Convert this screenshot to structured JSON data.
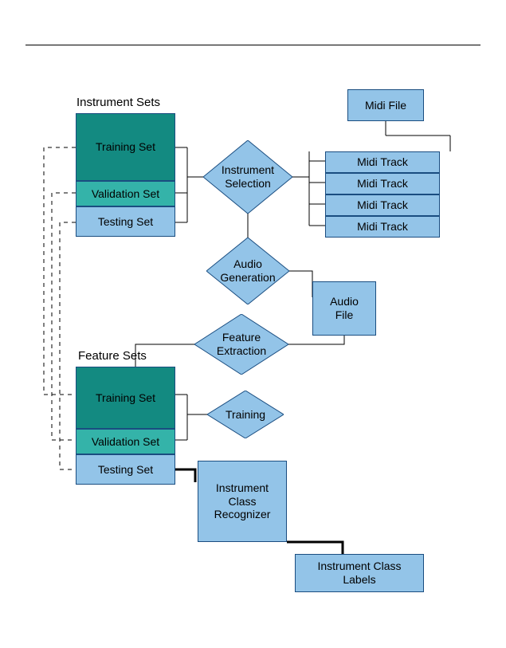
{
  "labels": {
    "instrument_sets": "Instrument Sets",
    "feature_sets": "Feature Sets"
  },
  "instrument_sets": {
    "training": "Training Set",
    "validation": "Validation Set",
    "testing": "Testing Set"
  },
  "feature_sets": {
    "training": "Training Set",
    "validation": "Validation Set",
    "testing": "Testing Set"
  },
  "midi": {
    "file": "Midi File",
    "track": "Midi Track"
  },
  "audio_file": "Audio\nFile",
  "diamonds": {
    "instrument_selection": "Instrument\nSelection",
    "audio_generation": "Audio\nGeneration",
    "feature_extraction": "Feature\nExtraction",
    "training": "Training"
  },
  "recognizer": "Instrument\nClass\nRecognizer",
  "output_labels": "Instrument Class\nLabels",
  "colors": {
    "box_fill": "#93c4e8",
    "box_stroke": "#1a4d80",
    "teal_dark": "#138a81",
    "teal_light": "#34b3a9"
  }
}
